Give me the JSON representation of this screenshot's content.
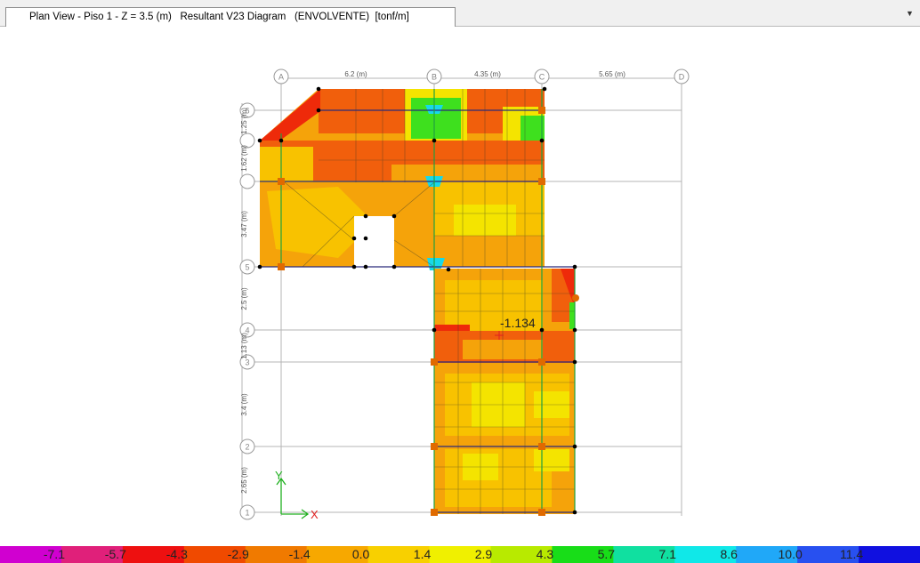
{
  "window": {
    "title": "Plan View - Piso 1 - Z = 3.5 (m)   Resultant V23 Diagram   (ENVOLVENTE)  [tonf/m]"
  },
  "grid": {
    "x_labels": [
      "A",
      "B",
      "C",
      "D"
    ],
    "y_labels": [
      "6",
      "5",
      "4",
      "3",
      "2",
      "1"
    ],
    "x_spacing_labels": [
      "6.2 (m)",
      "4.35 (m)",
      "5.65 (m)"
    ],
    "y_spacing_labels": [
      "1.25 (m)",
      "1.62 (m)",
      "3.47 (m)",
      "2.5 (m)",
      "1.13 (m)",
      "3.4 (m)",
      "2.65 (m)"
    ]
  },
  "annotation": {
    "value": "-1.134"
  },
  "axes": {
    "x_label": "X",
    "y_label": "Y"
  },
  "legend": {
    "labels": [
      "-7.1",
      "-5.7",
      "-4.3",
      "-2.9",
      "-1.4",
      "0.0",
      "1.4",
      "2.9",
      "4.3",
      "5.7",
      "7.1",
      "8.6",
      "10.0",
      "11.4"
    ],
    "colors": [
      "#d000d0",
      "#e0207a",
      "#ee1010",
      "#f04a00",
      "#f07a00",
      "#f7a800",
      "#f8d000",
      "#f0f000",
      "#b8ea00",
      "#18dd18",
      "#10e0a0",
      "#10e8e8",
      "#20a8f8",
      "#2850f0",
      "#1010e0"
    ]
  },
  "colors": {
    "red": "#ee2a0a",
    "orange_red": "#f15f0c",
    "orange": "#f5a30a",
    "yellow_orange": "#f8c200",
    "yellow": "#f4e400",
    "green": "#3ee01e",
    "cyan": "#18d8e8"
  }
}
